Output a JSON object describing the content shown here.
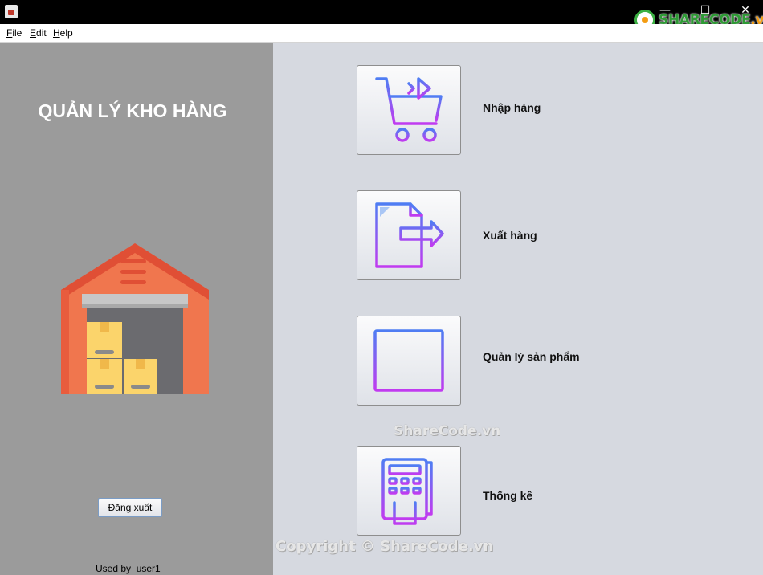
{
  "window": {
    "controls": {
      "minimize": "—",
      "maximize": "☐",
      "close": "✕"
    },
    "watermark_logo": {
      "brand": "SHARECODE",
      "domain": ".vn"
    }
  },
  "menubar": {
    "items": [
      {
        "mnemonic": "F",
        "rest": "ile"
      },
      {
        "mnemonic": "E",
        "rest": "dit"
      },
      {
        "mnemonic": "H",
        "rest": "elp"
      }
    ]
  },
  "sidebar": {
    "title": "QUẢN LÝ KHO HÀNG",
    "illustration": "warehouse-icon",
    "logout_label": "Đăng xuất",
    "user_text": "Used by  user1"
  },
  "main": {
    "tiles": [
      {
        "label": "Nhập hàng",
        "icon": "shopping-cart-icon"
      },
      {
        "label": "Xuất hàng",
        "icon": "document-export-icon"
      },
      {
        "label": "Quản lý sản phẩm",
        "icon": "browser-list-icon"
      },
      {
        "label": "Thống kê",
        "icon": "calculator-receipt-icon"
      }
    ]
  },
  "watermarks": {
    "center": "ShareCode.vn",
    "bottom": "Copyright © ShareCode.vn"
  },
  "colors": {
    "sidebar_bg": "#9b9b9b",
    "main_bg": "#d6d9e0",
    "icon_gradient_start": "#4f7df3",
    "icon_gradient_end": "#c13bf0",
    "warehouse_roof": "#e85c3d",
    "warehouse_wall": "#f0764e",
    "box_color": "#fbd46b"
  }
}
